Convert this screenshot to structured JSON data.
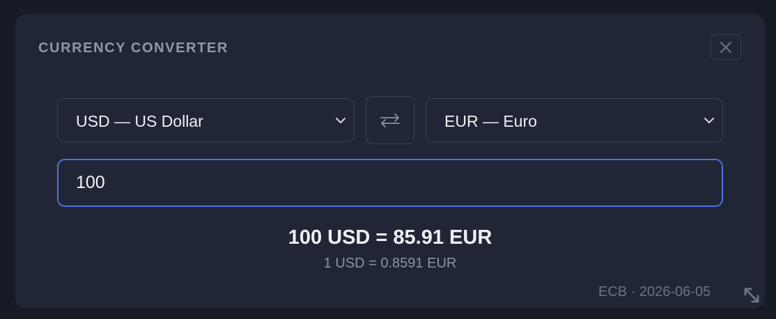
{
  "converter": {
    "title": "CURRENCY CONVERTER",
    "close_icon": "close-icon",
    "from_currency": "USD — US Dollar",
    "to_currency": "EUR — Euro",
    "swap_icon": "swap-arrows-icon",
    "amount": "100",
    "result": "100 USD = 85.91 EUR",
    "rate": "1 USD = 0.8591 EUR",
    "source": "ECB · 2026-06-05",
    "resize_icon": "resize-handle-icon"
  },
  "colors": {
    "background": "#171b26",
    "panel": "#212636",
    "accent": "#4b72e0",
    "text": "#eef0f5",
    "muted": "#8a93a6"
  }
}
